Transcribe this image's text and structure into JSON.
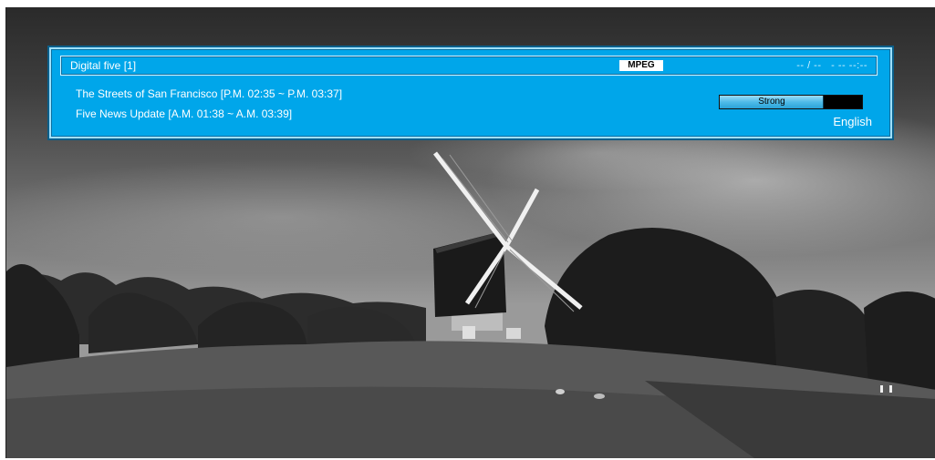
{
  "info_banner": {
    "channel_name": "Digital five [1]",
    "video_codec": "MPEG",
    "datetime": "-- / --   - -- --:--",
    "current_program": "The Streets of San Francisco [P.M. 02:35 ~ P.M. 03:37]",
    "next_program": "Five News Update [A.M. 01:38 ~ A.M. 03:39]",
    "signal": {
      "label": "Strong",
      "level": 0.73
    },
    "audio_language": "English"
  },
  "colors": {
    "banner_background": "#00a6ea",
    "banner_border": "#9fe0ff",
    "text": "#ffffff"
  }
}
